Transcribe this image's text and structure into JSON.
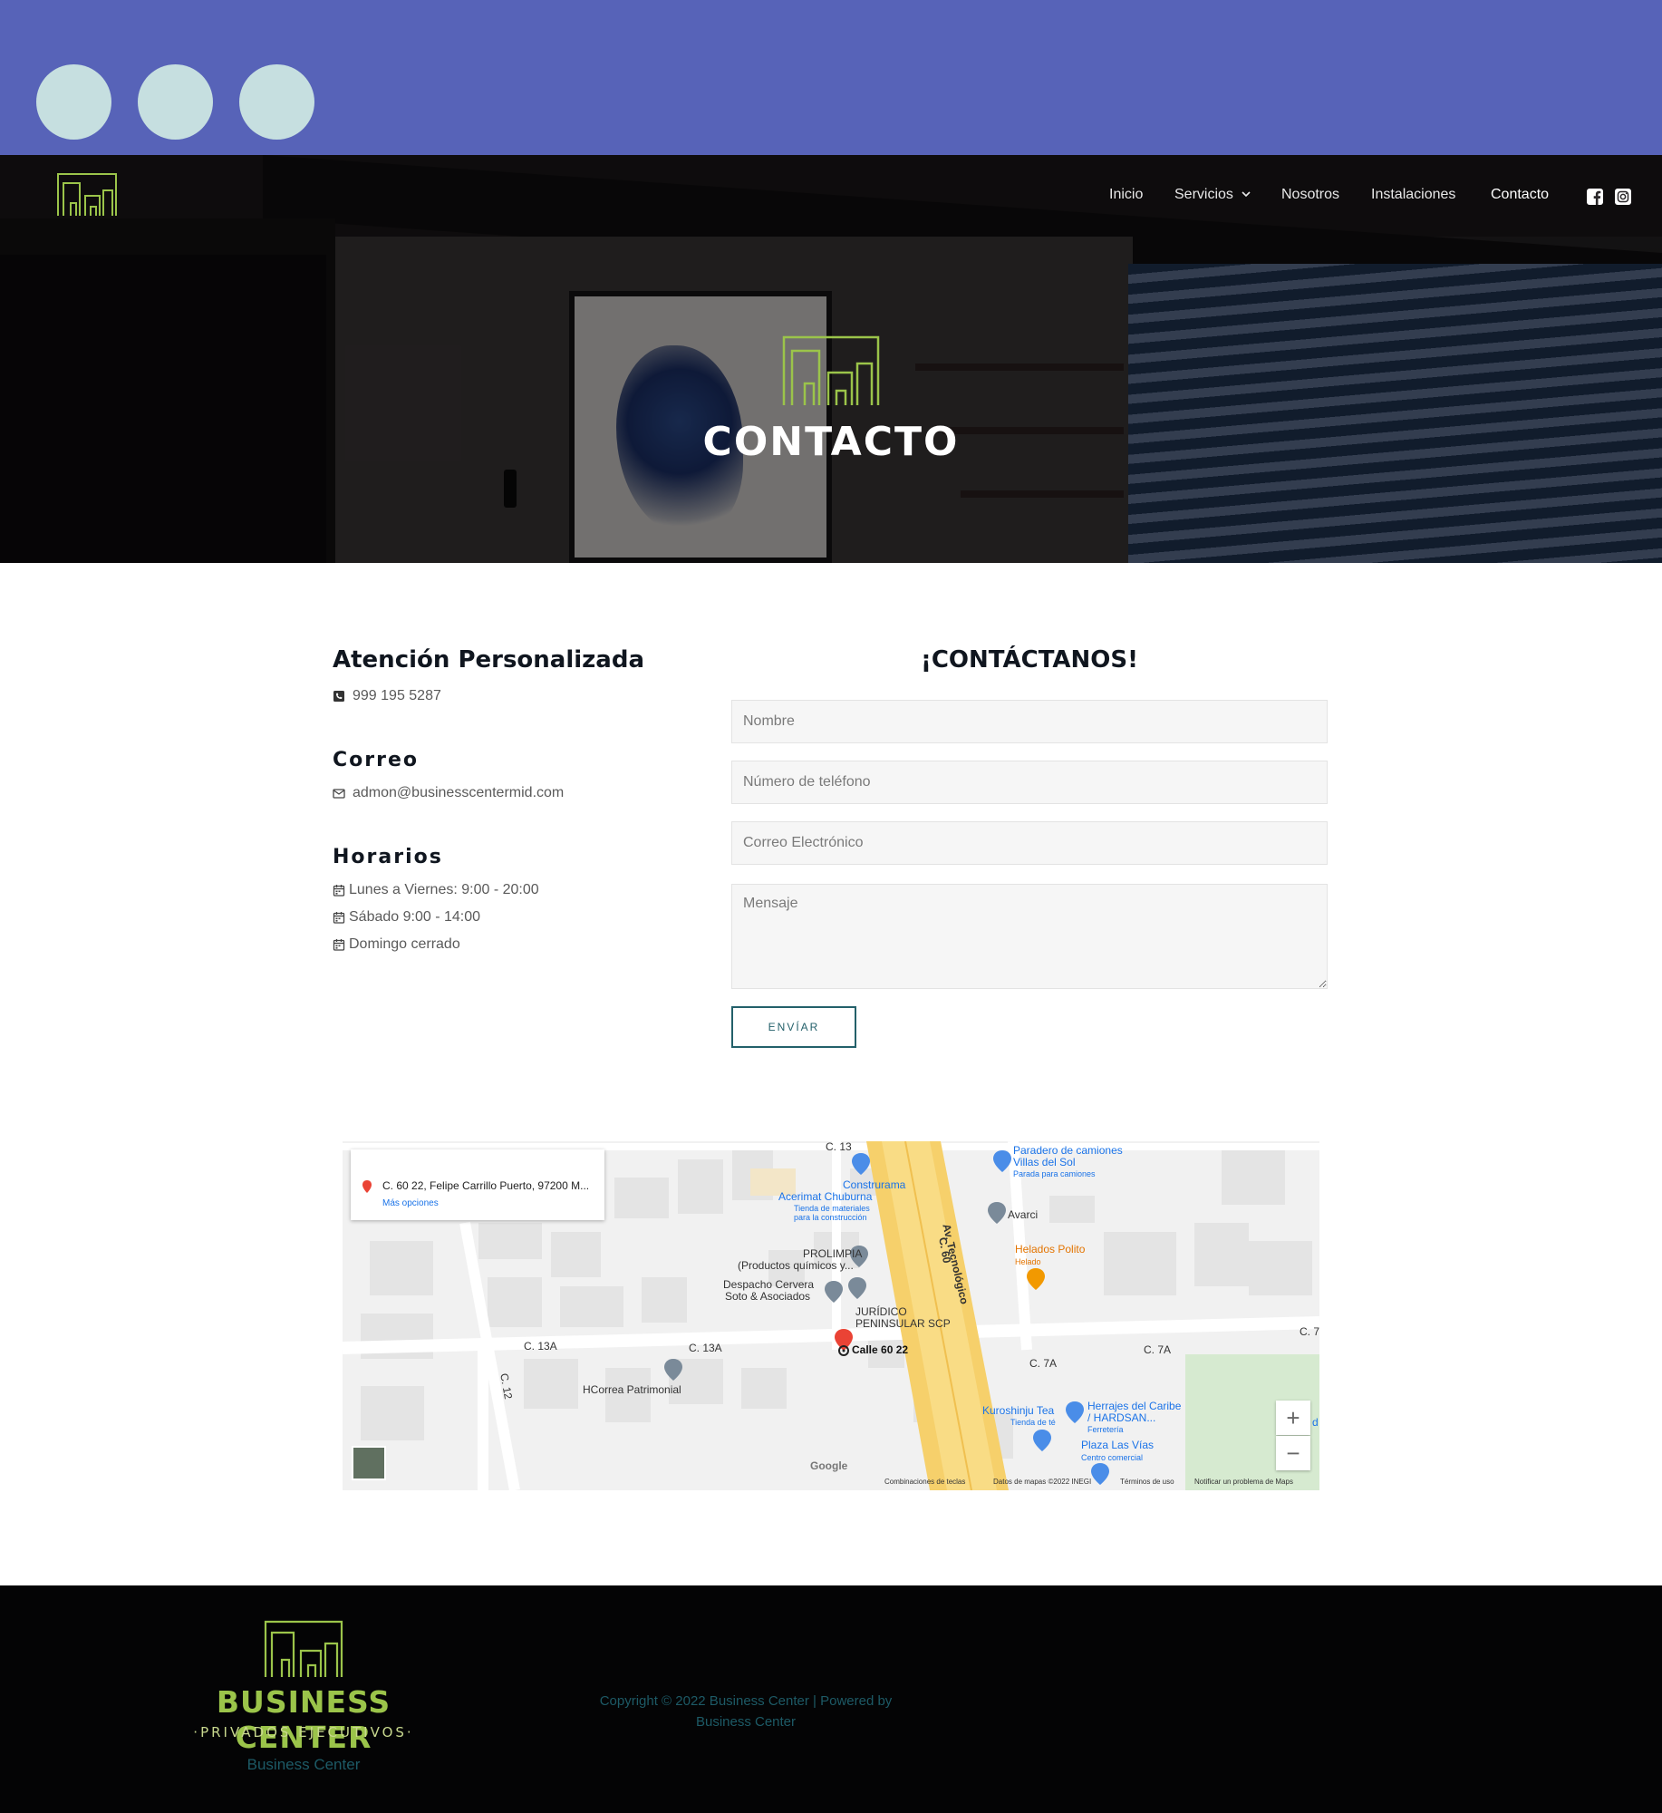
{
  "colors": {
    "top_band": "#5763b8",
    "circle": "#c6dfe0",
    "accent_green": "#9bc44a",
    "teal": "#23606a",
    "footer_bg": "#040405"
  },
  "nav": {
    "items": [
      {
        "label": "Inicio"
      },
      {
        "label": "Servicios"
      },
      {
        "label": "Nosotros"
      },
      {
        "label": "Instalaciones"
      },
      {
        "label": "Contacto"
      }
    ],
    "social": [
      "facebook-icon",
      "instagram-icon"
    ]
  },
  "hero": {
    "title": "CONTACTO"
  },
  "contact": {
    "attention_heading": "Atención Personalizada",
    "phone": "999 195 5287",
    "email_heading": "Correo",
    "email": "admon@businesscentermid.com",
    "hours_heading": "Horarios",
    "hours": [
      "Lunes a Viernes: 9:00 - 20:00",
      "Sábado 9:00 - 14:00",
      "Domingo cerrado"
    ]
  },
  "form": {
    "heading": "¡CONTÁCTANOS!",
    "name_placeholder": "Nombre",
    "phone_placeholder": "Número de teléfono",
    "email_placeholder": "Correo Electrónico",
    "message_placeholder": "Mensaje",
    "submit_label": "ENVÍAR"
  },
  "map": {
    "card_address": "C. 60 22, Felipe Carrillo Puerto, 97200 M...",
    "card_more": "Más opciones",
    "labels": {
      "c13": "C. 13",
      "constru1": "Construrama",
      "constru2": "Acerimat Chuburna",
      "constru3": "Tienda de materiales",
      "constru4": "para la construcción",
      "paradero1": "Paradero de camiones",
      "paradero2": "Villas del Sol",
      "paradero3": "Parada para camiones",
      "avtec": "Av. Tecnológico",
      "c60": "C. 60",
      "avarci": "Avarci",
      "prolimpia1": "PROLIMPIA",
      "prolimpia2": "(Productos químicos y...",
      "helados1": "Helados Polito",
      "helados2": "Helado",
      "despacho1": "Despacho Cervera",
      "despacho2": "Soto & Asociados",
      "juridico1": "JURÍDICO",
      "juridico2": "PENINSULAR SCP",
      "c13a_1": "C. 13A",
      "c13a_2": "C. 13A",
      "calle6022": "Calle 60 22",
      "c7a_1": "C. 7A",
      "c7a_2": "C. 7A",
      "c7": "C. 7",
      "c12": "C. 12",
      "hcorrea": "HCorrea Patrimonial",
      "kuro1": "Kuroshinju Tea",
      "kuro2": "Tienda de té",
      "herrajes1": "Herrajes del Caribe",
      "herrajes2": "/ HARDSAN...",
      "herrajes3": "Ferretería",
      "plaza1": "Plaza Las Vías",
      "plaza2": "Centro comercial",
      "d": "d"
    },
    "zoom_in": "+",
    "zoom_out": "−",
    "google": "Google",
    "footer": {
      "shortcuts": "Combinaciones de teclas",
      "data": "Datos de mapas ©2022 INEGI",
      "terms": "Términos de uso",
      "report": "Notificar un problema de Maps"
    }
  },
  "footer": {
    "brand": "BUSINESS CENTER",
    "brand_sub": "·PRIVADOS EJECUTIVOS·",
    "name": "Business Center",
    "copyright_line1": "Copyright © 2022 Business Center | Powered by",
    "copyright_line2": "Business Center"
  }
}
